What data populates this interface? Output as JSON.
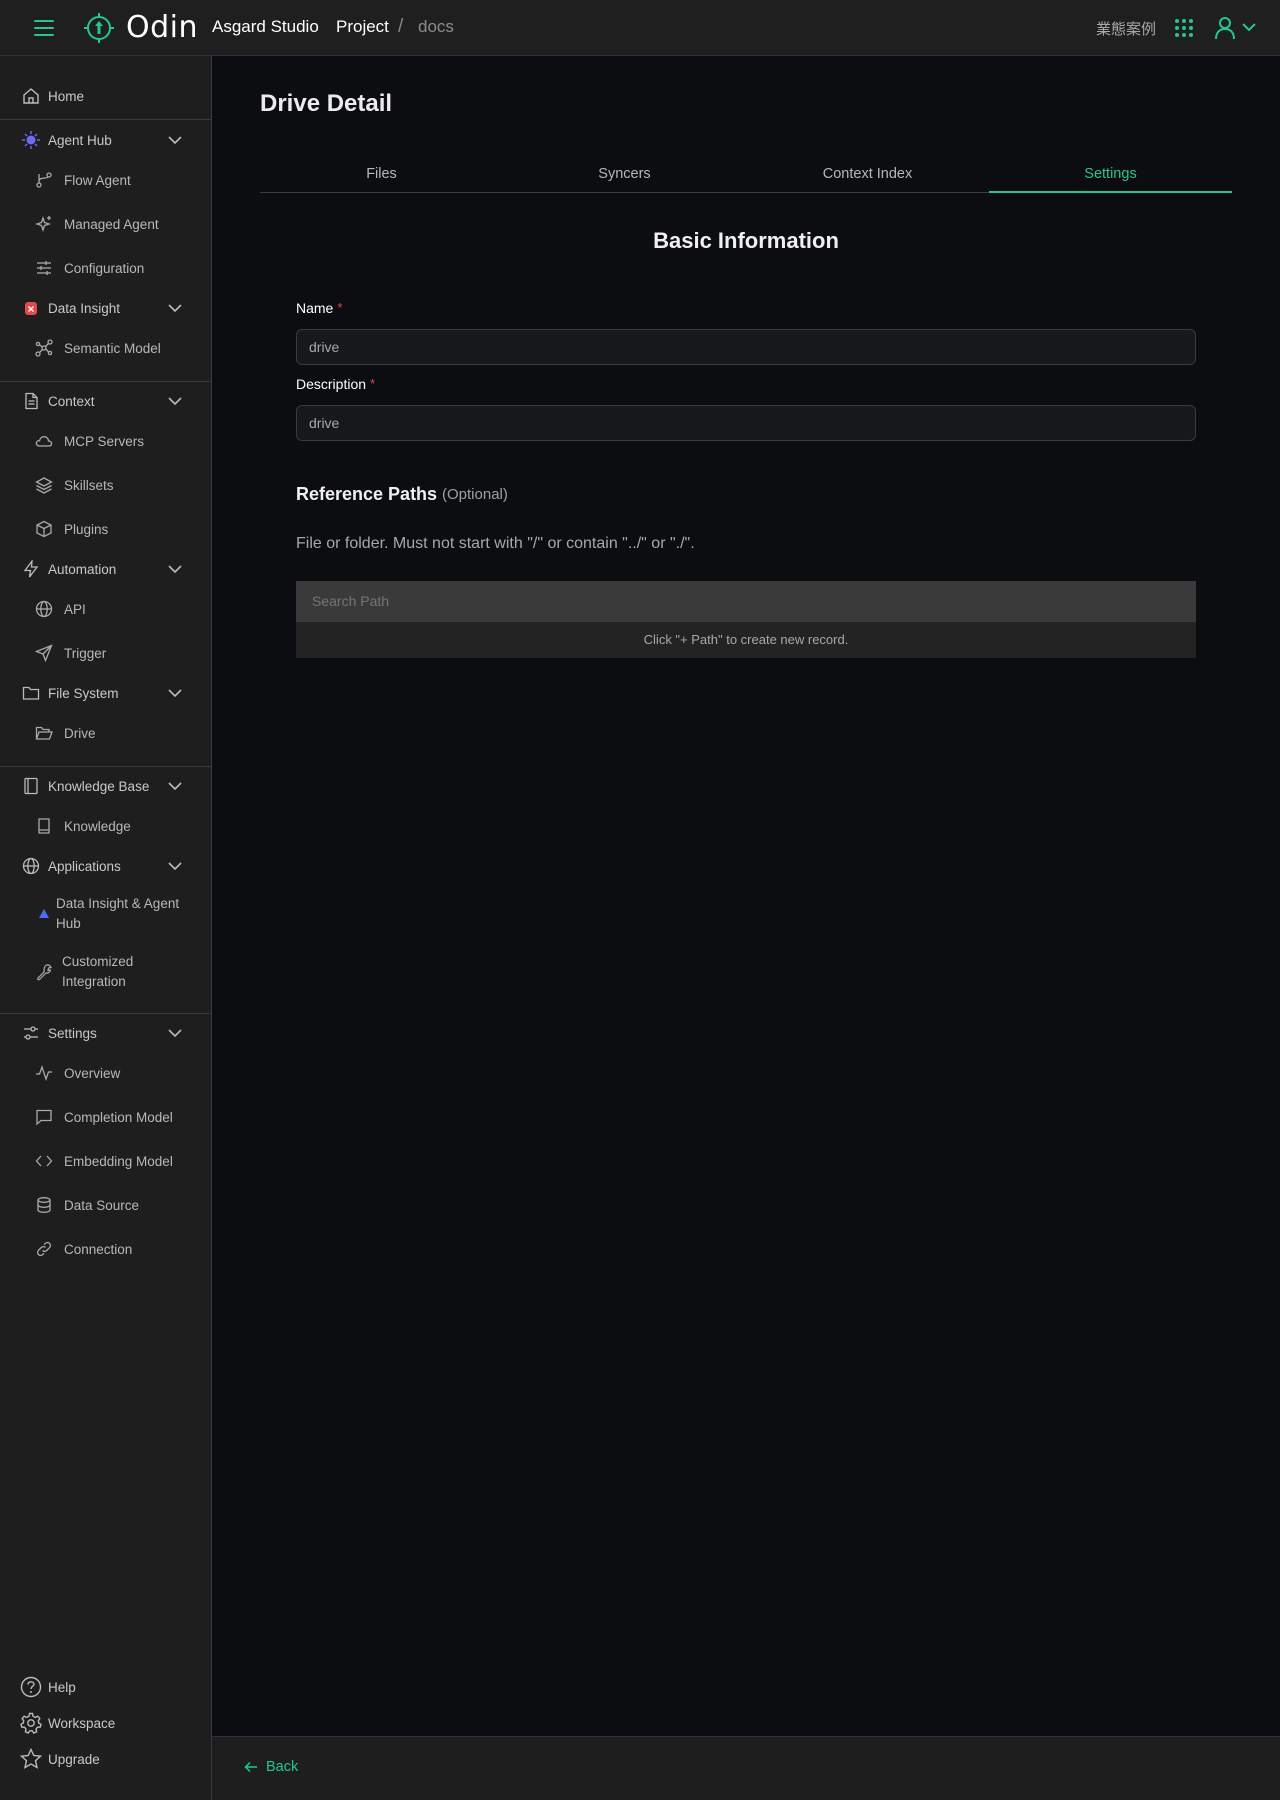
{
  "colors": {
    "accent": "#24c78e",
    "required": "#e5484d",
    "agent_hub_icon": "#6b6bf5",
    "data_insight_icon": "#e5484d",
    "app_icon": "#4a6cf7"
  },
  "header": {
    "brand": "Odin",
    "studio": "Asgard Studio",
    "breadcrumb": {
      "project": "Project",
      "separator": "/",
      "current": "docs"
    },
    "case_link": "業態案例"
  },
  "sidebar": {
    "home": "Home",
    "agent_hub": {
      "label": "Agent Hub",
      "items": [
        "Flow Agent",
        "Managed Agent",
        "Configuration"
      ]
    },
    "data_insight": {
      "label": "Data Insight",
      "items": [
        "Semantic Model"
      ]
    },
    "context": {
      "label": "Context",
      "items": [
        "MCP Servers",
        "Skillsets",
        "Plugins"
      ]
    },
    "automation": {
      "label": "Automation",
      "items": [
        "API",
        "Trigger"
      ]
    },
    "file_system": {
      "label": "File System",
      "items": [
        "Drive"
      ]
    },
    "knowledge_base": {
      "label": "Knowledge Base",
      "items": [
        "Knowledge"
      ]
    },
    "applications": {
      "label": "Applications",
      "items": [
        "Data Insight & Agent Hub",
        "Customized Integration"
      ]
    },
    "settings": {
      "label": "Settings",
      "items": [
        "Overview",
        "Completion Model",
        "Embedding Model",
        "Data Source",
        "Connection"
      ]
    },
    "bottom": {
      "help": "Help",
      "workspace": "Workspace",
      "upgrade": "Upgrade"
    }
  },
  "main": {
    "title": "Drive Detail",
    "tabs": [
      "Files",
      "Syncers",
      "Context Index",
      "Settings"
    ],
    "active_tab": "Settings",
    "basic_info": {
      "title": "Basic Information",
      "name_label": "Name",
      "name_value": "drive",
      "description_label": "Description",
      "description_value": "drive",
      "required_mark": "*"
    },
    "reference_paths": {
      "title": "Reference Paths",
      "optional": "(Optional)",
      "help": "File or folder. Must not start with \"/\" or contain \"../\" or \"./\".",
      "search_placeholder": "Search Path",
      "empty_text": "Click \"+ Path\" to create new record."
    }
  },
  "footer": {
    "back": "Back"
  }
}
